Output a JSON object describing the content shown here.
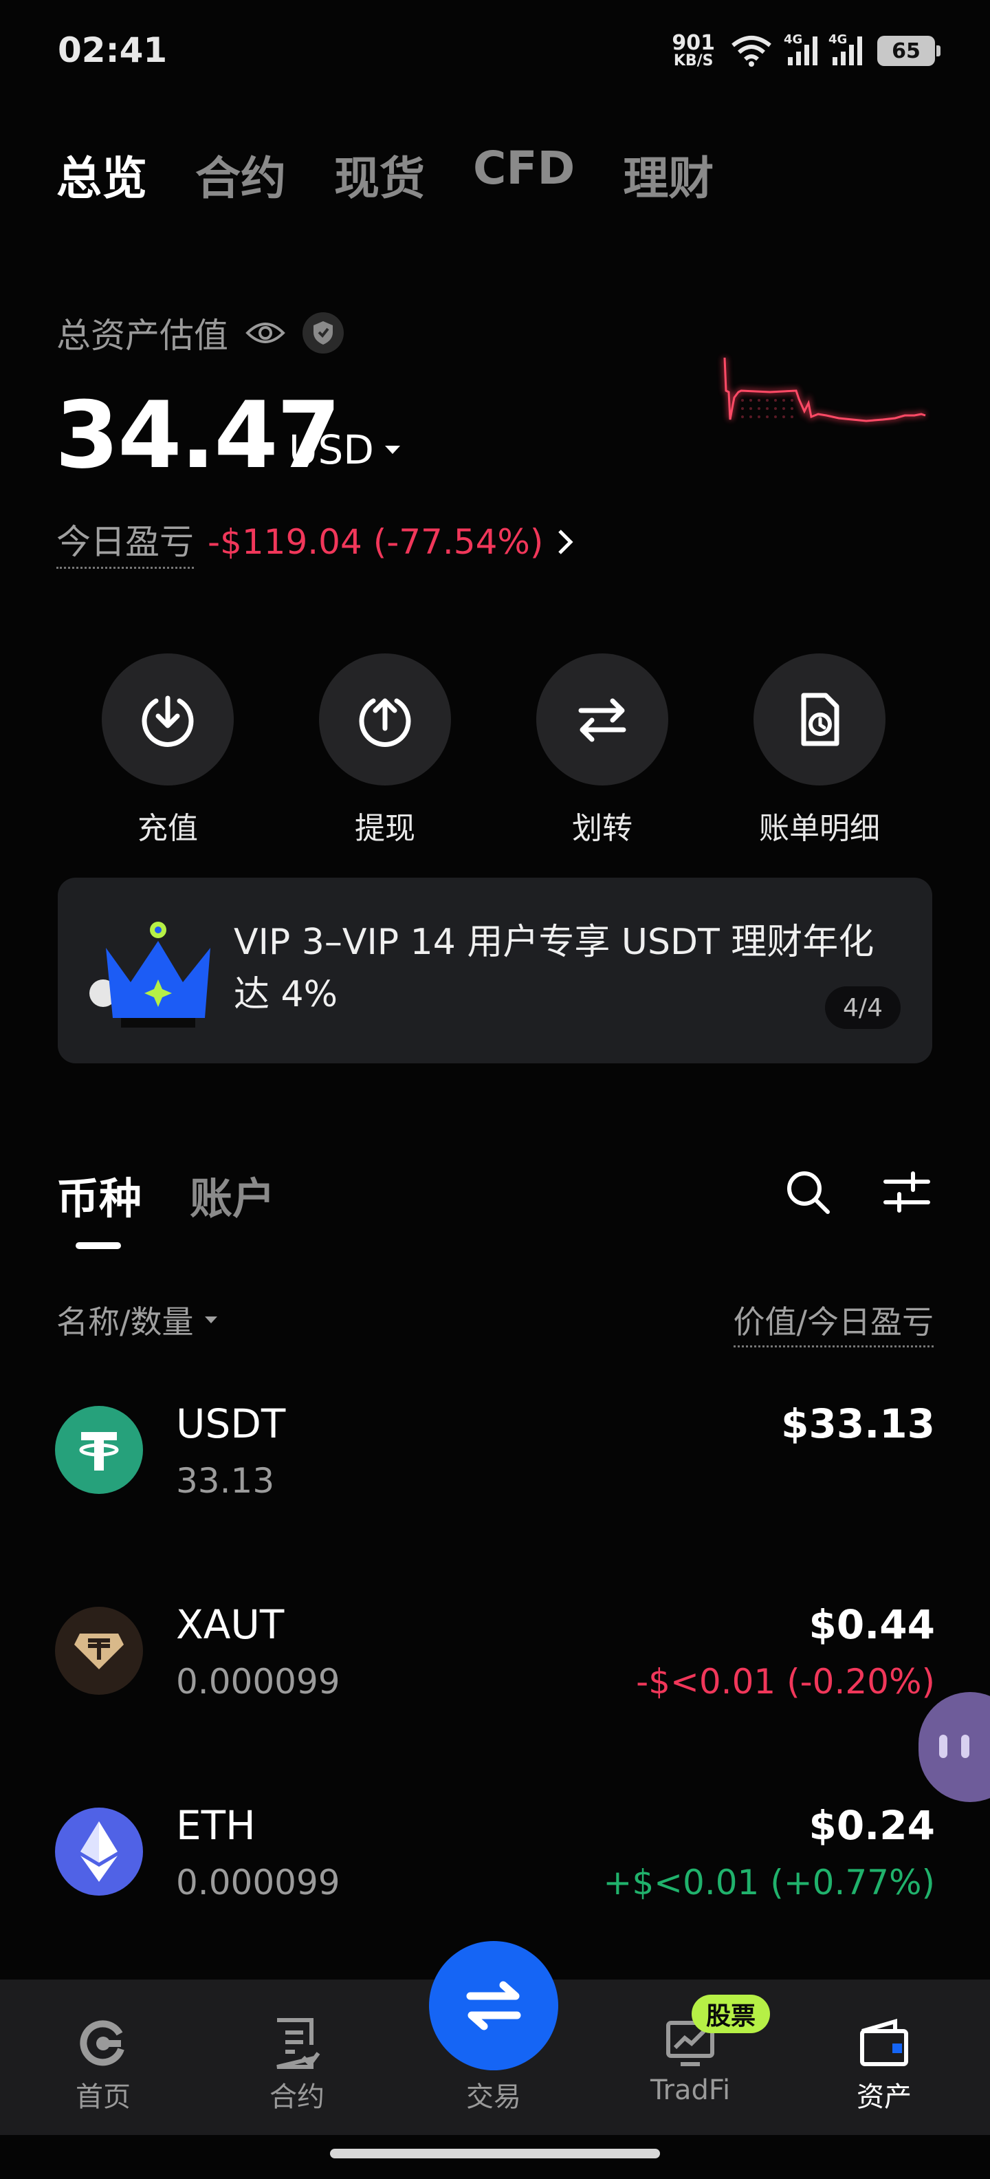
{
  "status_bar": {
    "time": "02:41",
    "net_speed_value": "901",
    "net_speed_unit": "KB/S",
    "signal_tag_1": "4G",
    "signal_tag_2": "4G",
    "battery": "65",
    "icons": [
      "wifi-icon",
      "signal-icon",
      "signal-icon",
      "battery-icon"
    ]
  },
  "top_tabs": [
    {
      "label": "总览",
      "active": true
    },
    {
      "label": "合约",
      "active": false
    },
    {
      "label": "现货",
      "active": false
    },
    {
      "label": "CFD",
      "active": false
    },
    {
      "label": "理财",
      "active": false
    }
  ],
  "summary": {
    "label": "总资产估值",
    "balance": "34.47",
    "currency": "USD",
    "pnl_label": "今日盈亏",
    "pnl_value": "-$119.04 (-77.54%)"
  },
  "actions": [
    {
      "label": "充值",
      "icon": "deposit-icon"
    },
    {
      "label": "提现",
      "icon": "withdraw-icon"
    },
    {
      "label": "划转",
      "icon": "transfer-icon"
    },
    {
      "label": "账单明细",
      "icon": "bill-icon"
    }
  ],
  "banner": {
    "text": "VIP 3–VIP 14 用户专享 USDT 理财年化达 4%",
    "page": "4/4",
    "icon": "crown-icon"
  },
  "section_tabs": [
    {
      "label": "币种",
      "active": true
    },
    {
      "label": "账户",
      "active": false
    }
  ],
  "list_header": {
    "left": "名称/数量",
    "right": "价值/今日盈亏"
  },
  "assets": [
    {
      "symbol": "USDT",
      "quantity": "33.13",
      "value": "$33.13",
      "pnl": "",
      "pnl_color": "#f1375a",
      "icon_color": "#26a17b"
    },
    {
      "symbol": "XAUT",
      "quantity": "0.000099",
      "value": "$0.44",
      "pnl": "-$<0.01 (-0.20%)",
      "pnl_color": "#f1375a",
      "icon_color": "#2a1f18"
    },
    {
      "symbol": "ETH",
      "quantity": "0.000099",
      "value": "$0.24",
      "pnl": "+$<0.01 (+0.77%)",
      "pnl_color": "#20b26c",
      "icon_color": "#5062e6"
    }
  ],
  "bottom_nav": [
    {
      "label": "首页",
      "icon": "home-icon",
      "active": false
    },
    {
      "label": "合约",
      "icon": "contract-icon",
      "active": false
    },
    {
      "label": "交易",
      "icon": "trade-icon",
      "active": false
    },
    {
      "label": "TradFi",
      "icon": "tradfi-icon",
      "active": false
    },
    {
      "label": "资产",
      "icon": "assets-icon",
      "active": true
    }
  ],
  "stock_badge": "股票",
  "colors": {
    "background": "#050505",
    "negative": "#f1375a",
    "positive": "#20b26c",
    "accent": "#1565f5"
  }
}
